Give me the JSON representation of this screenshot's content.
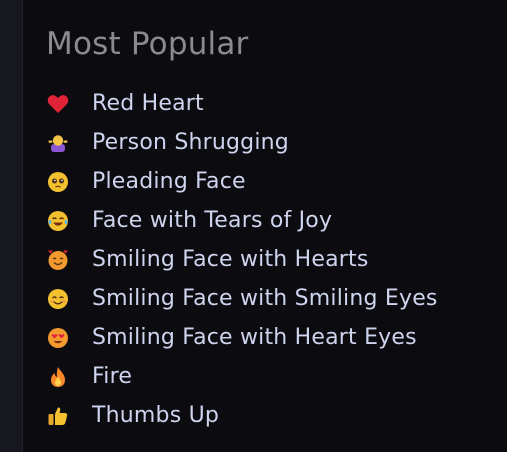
{
  "title": "Most Popular",
  "items": [
    {
      "label": "Red Heart",
      "icon": "red-heart-icon"
    },
    {
      "label": "Person Shrugging",
      "icon": "person-shrugging-icon"
    },
    {
      "label": "Pleading Face",
      "icon": "pleading-face-icon"
    },
    {
      "label": "Face with Tears of Joy",
      "icon": "tears-of-joy-icon"
    },
    {
      "label": "Smiling Face with Hearts",
      "icon": "smiling-face-with-hearts-icon"
    },
    {
      "label": "Smiling Face with Smiling Eyes",
      "icon": "smiling-eyes-icon"
    },
    {
      "label": "Smiling Face with Heart Eyes",
      "icon": "heart-eyes-icon"
    },
    {
      "label": "Fire",
      "icon": "fire-icon"
    },
    {
      "label": "Thumbs Up",
      "icon": "thumbs-up-icon"
    }
  ],
  "colors": {
    "background": "#0c0b10",
    "title": "#8a8a90",
    "label": "#cfd4ee",
    "heart": "#e02438",
    "face": "#f3c12f",
    "face_warm": "#f29a2e",
    "fire": "#f6872b",
    "purple": "#8b57d2"
  }
}
